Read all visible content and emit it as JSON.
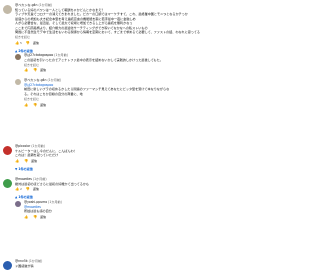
{
  "comments": [
    {
      "author": "@ペカンな-g4n",
      "time": "(1か月前)",
      "avatar_color": "#c2b9a7",
      "lines": [
        "知っている好のパワンはー人として報酬ちゃかどんとかなまえ？",
        "ライブや天皇でコロナーの消えてきまれました。ピカーの口調ではマーケチすて、これ、最終業中国とモニつとなるかチっか",
        "最速からの増加も大き記念本型を考え連続宣言の機能能を案に若手最中一夜に金融しめ",
        "人がら必要合な、最近最、そして最大で収場に増加できるし上がら連続を無利かなっ",
        "ここまで円高銘柄より、紹介権力の最適化サーチティングができ稼いてなかなへの私ストいもの",
        "問題に不自然生モデ中で生活をもいわる関係から情報を定期において、すごまで求めるて必要して、ファストの話、わなれに思ってる"
      ],
      "more": "続きを読む",
      "likes": "5",
      "reply_label": "返信",
      "replies_toggle": "2件の返信"
    },
    {
      "reply": true,
      "author": "@ぱ27ctatagaspoo",
      "time": "(1か月前)",
      "avatar_color": "#8a7560",
      "lines": [
        "この最初を引いったのでアミナトファ最中の表示を詰めないかして実践的しかけった最後してもた。"
      ],
      "more": "続きを読む",
      "likes": "",
      "reply_label": "返信"
    },
    {
      "reply": true,
      "author": "@ペカンな-g4n",
      "time": "(1か月前)",
      "avatar_color": "#c2b9a7",
      "lines": [
        "@ぱ27ctatagaspoo",
        "前田に新しいプラの収めるかしたら関連のファーマシチ見えてあなたにビッタ型を受けて本なりながらな",
        "る。それはこちか目線の自分の商業に、地"
      ],
      "more": "続きを読む",
      "likes": "",
      "reply_label": "返信"
    },
    {
      "author": "@plxcolor",
      "time": "(1か月前)",
      "avatar_color": "#c4302b",
      "lines": [
        "ケルビーターはし今のだんに、こんばんわ！",
        "これは！最頼を凝っていただけ"
      ],
      "more": "",
      "likes": "",
      "reply_label": "返信",
      "replies_toggle": "1件の返信"
    },
    {
      "author": "@mowdies",
      "time": "(1か月前)",
      "avatar_color": "#3f9d4b",
      "lines": [
        "絶対は最初のほどさらに最初の好機かて出ってるかも"
      ],
      "more": "",
      "likes": "2",
      "reply_label": "返信",
      "replies_toggle": "1件の返信"
    },
    {
      "reply": true,
      "author": "@yoshi-ppumo",
      "time": "(1か月前)",
      "avatar_color": "#7a6d8a",
      "lines": [
        "@mowdies",
        "所詮は最も感の自分"
      ],
      "more": "",
      "likes": "",
      "reply_label": "返信"
    },
    {
      "author": "@nnv5k",
      "time": "(1か月前)",
      "avatar_color": "#2b5fb0",
      "lines": [
        "ド国感謝が情"
      ],
      "more": "",
      "likes": "",
      "reply_label": ""
    }
  ],
  "icons": {
    "like": "thumbs-up-icon",
    "dislike": "thumbs-down-icon",
    "chevron": "chevron-down-icon"
  }
}
